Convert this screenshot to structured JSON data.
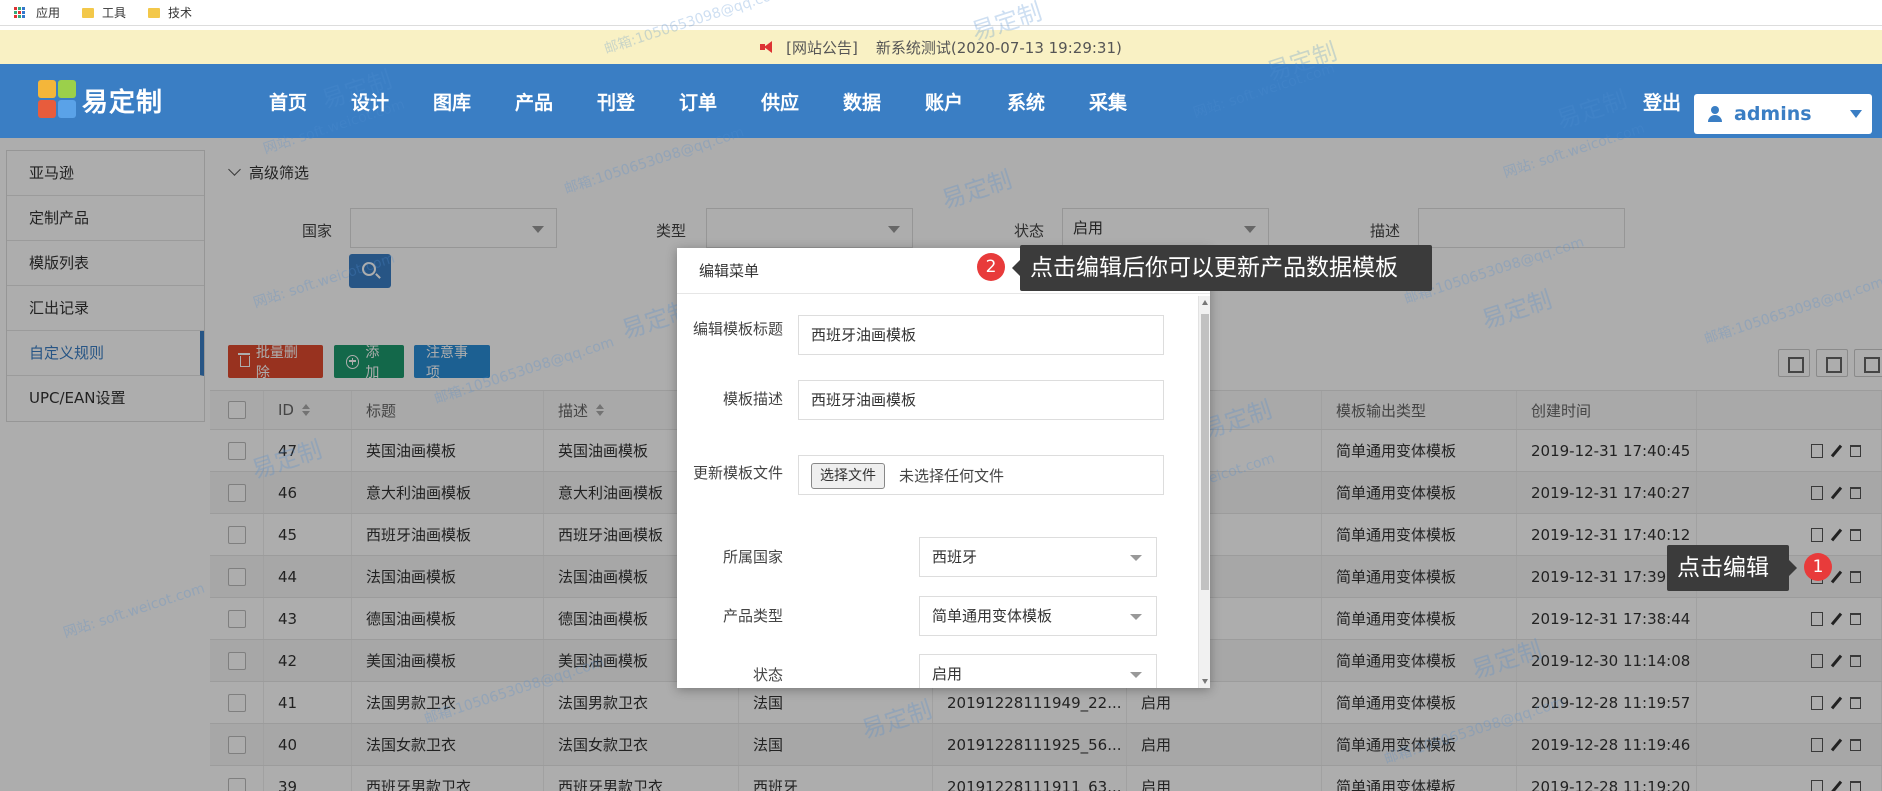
{
  "bookmarks": [
    {
      "label": "应用",
      "icon": "apps-grid-icon"
    },
    {
      "label": "工具",
      "icon": "folder-icon"
    },
    {
      "label": "技术",
      "icon": "folder-icon"
    }
  ],
  "notice": {
    "tag": "[网站公告]",
    "text": "新系统测试(2020-07-13 19:29:31)",
    "icon": "speaker-icon"
  },
  "header": {
    "logo_text": "易定制",
    "nav": [
      "首页",
      "设计",
      "图库",
      "产品",
      "刊登",
      "订单",
      "供应",
      "数据",
      "账户",
      "系统",
      "采集"
    ],
    "logout": "登出",
    "user": "admins"
  },
  "sidebar": {
    "items": [
      "亚马逊",
      "定制产品",
      "模版列表",
      "汇出记录",
      "自定义规则",
      "UPC/EAN设置"
    ],
    "active_index": 4
  },
  "filter": {
    "title": "高级筛选",
    "country_label": "国家",
    "country_value": "",
    "type_label": "类型",
    "type_value": "",
    "status_label": "状态",
    "status_value": "启用",
    "desc_label": "描述",
    "desc_value": ""
  },
  "actions": {
    "batch_delete": "批量删除",
    "add": "添加",
    "notes": "注意事项"
  },
  "table": {
    "columns": [
      "ID",
      "标题",
      "描述",
      "",
      "",
      "",
      "模板输出类型",
      "创建时间",
      ""
    ],
    "rows": [
      {
        "id": "47",
        "title": "英国油画模板",
        "desc": "英国油画模板",
        "country": "",
        "file": "",
        "status": "",
        "output": "简单通用变体模板",
        "created": "2019-12-31 17:40:45"
      },
      {
        "id": "46",
        "title": "意大利油画模板",
        "desc": "意大利油画模板",
        "country": "",
        "file": "",
        "status": "",
        "output": "简单通用变体模板",
        "created": "2019-12-31 17:40:27"
      },
      {
        "id": "45",
        "title": "西班牙油画模板",
        "desc": "西班牙油画模板",
        "country": "",
        "file": "",
        "status": "",
        "output": "简单通用变体模板",
        "created": "2019-12-31 17:40:12"
      },
      {
        "id": "44",
        "title": "法国油画模板",
        "desc": "法国油画模板",
        "country": "",
        "file": "",
        "status": "",
        "output": "简单通用变体模板",
        "created": "2019-12-31 17:39:5"
      },
      {
        "id": "43",
        "title": "德国油画模板",
        "desc": "德国油画模板",
        "country": "",
        "file": "",
        "status": "",
        "output": "简单通用变体模板",
        "created": "2019-12-31 17:38:44"
      },
      {
        "id": "42",
        "title": "美国油画模板",
        "desc": "美国油画模板",
        "country": "",
        "file": "",
        "status": "",
        "output": "简单通用变体模板",
        "created": "2019-12-30 11:14:08"
      },
      {
        "id": "41",
        "title": "法国男款卫衣",
        "desc": "法国男款卫衣",
        "country": "法国",
        "file": "20191228111949_22...",
        "status": "启用",
        "output": "简单通用变体模板",
        "created": "2019-12-28 11:19:57"
      },
      {
        "id": "40",
        "title": "法国女款卫衣",
        "desc": "法国女款卫衣",
        "country": "法国",
        "file": "20191228111925_56...",
        "status": "启用",
        "output": "简单通用变体模板",
        "created": "2019-12-28 11:19:46"
      },
      {
        "id": "39",
        "title": "西班牙男款卫衣",
        "desc": "西班牙男款卫衣",
        "country": "西班牙",
        "file": "20191228111911_63...",
        "status": "启用",
        "output": "简单通用变体模板",
        "created": "2019-12-28 11:19:20"
      }
    ]
  },
  "modal": {
    "title": "编辑菜单",
    "title_label": "编辑模板标题",
    "title_value": "西班牙油画模板",
    "desc_label": "模板描述",
    "desc_value": "西班牙油画模板",
    "file_label": "更新模板文件",
    "file_button": "选择文件",
    "file_status": "未选择任何文件",
    "country_label": "所属国家",
    "country_value": "西班牙",
    "type_label": "产品类型",
    "type_value": "简单通用变体模板",
    "status_label": "状态",
    "status_value": "启用"
  },
  "tips": {
    "tip1_badge": "1",
    "tip1_text": "点击编辑",
    "tip2_badge": "2",
    "tip2_text": "点击编辑后你可以更新产品数据模板"
  },
  "watermarks": {
    "brand": "易定制",
    "site": "网站: soft.weicot.com",
    "mail": "邮箱:1050653098@qq.com"
  }
}
